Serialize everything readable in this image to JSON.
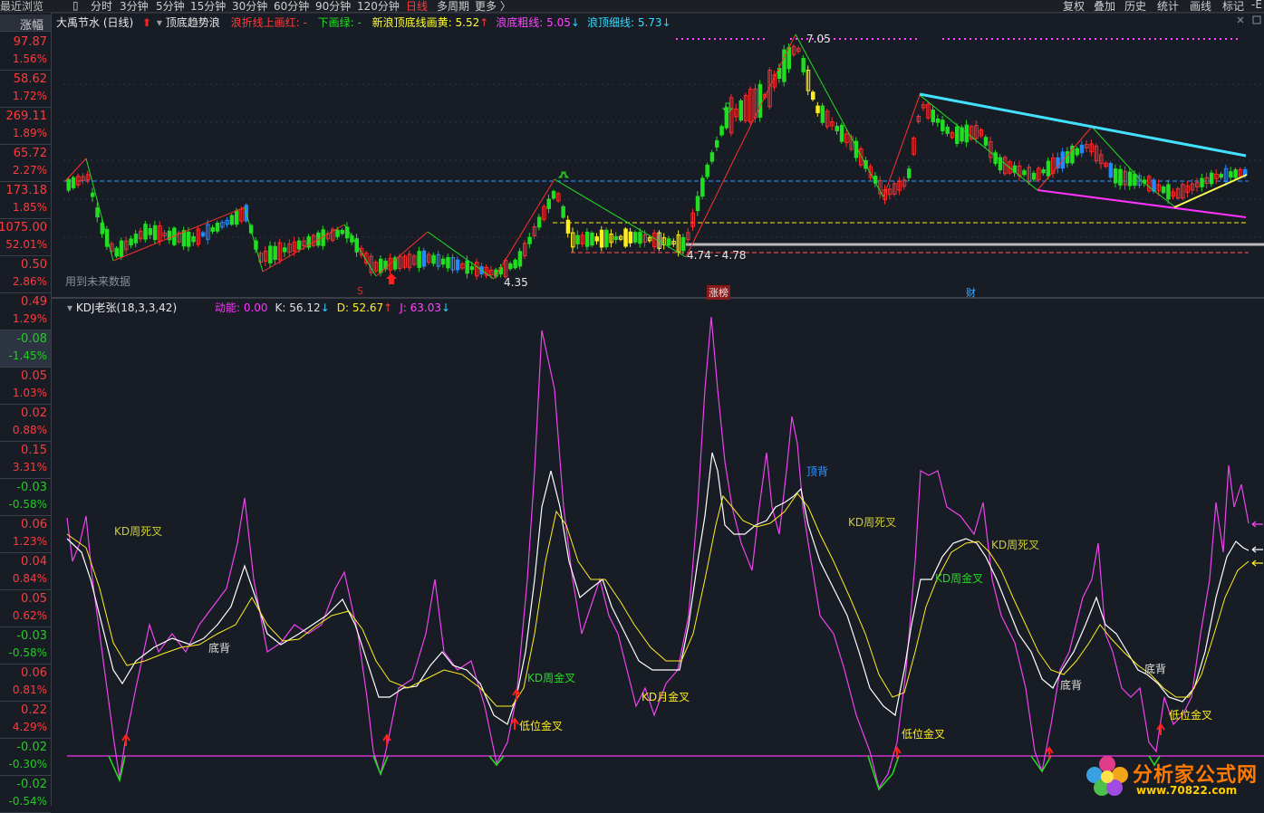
{
  "topbar": {
    "recent": "最近浏览",
    "periods": [
      "分时",
      "3分钟",
      "5分钟",
      "15分钟",
      "30分钟",
      "60分钟",
      "90分钟",
      "120分钟",
      "日线",
      "多周期",
      "更多 〉"
    ],
    "active_period": "日线",
    "right_buttons": [
      "复权",
      "叠加",
      "历史",
      "统计",
      "画线",
      "标记"
    ],
    "edge": "-E"
  },
  "sidebar": {
    "header": "涨幅",
    "items": [
      {
        "price": "97.87",
        "change": "1.56%",
        "dir": "up"
      },
      {
        "price": "58.62",
        "change": "1.72%",
        "dir": "up"
      },
      {
        "price": "269.11",
        "change": "1.89%",
        "dir": "up"
      },
      {
        "price": "65.72",
        "change": "2.27%",
        "dir": "up"
      },
      {
        "price": "173.18",
        "change": "1.85%",
        "dir": "up"
      },
      {
        "price": "1075.00",
        "change": "52.01%",
        "dir": "up"
      },
      {
        "price": "0.50",
        "change": "2.86%",
        "dir": "up"
      },
      {
        "price": "0.49",
        "change": "1.29%",
        "dir": "up"
      },
      {
        "price": "-0.08",
        "change": "-1.45%",
        "dir": "down",
        "selected": true
      },
      {
        "price": "0.05",
        "change": "1.03%",
        "dir": "up"
      },
      {
        "price": "0.02",
        "change": "0.88%",
        "dir": "up"
      },
      {
        "price": "0.15",
        "change": "3.31%",
        "dir": "up"
      },
      {
        "price": "-0.03",
        "change": "-0.58%",
        "dir": "down"
      },
      {
        "price": "0.06",
        "change": "1.23%",
        "dir": "up"
      },
      {
        "price": "0.04",
        "change": "0.84%",
        "dir": "up"
      },
      {
        "price": "0.05",
        "change": "0.62%",
        "dir": "up"
      },
      {
        "price": "-0.03",
        "change": "-0.58%",
        "dir": "down"
      },
      {
        "price": "0.06",
        "change": "0.81%",
        "dir": "up"
      },
      {
        "price": "0.22",
        "change": "4.29%",
        "dir": "up"
      },
      {
        "price": "-0.02",
        "change": "-0.30%",
        "dir": "down"
      },
      {
        "price": "-0.02",
        "change": "-0.54%",
        "dir": "down"
      }
    ]
  },
  "price_panel": {
    "title": "大禹节水 (日线)",
    "indicator": "顶底趋势浪",
    "legend": [
      {
        "text": "浪折线上画红:",
        "value": " - ",
        "color": "#ff3b3b"
      },
      {
        "text": "下画绿:",
        "value": " - ",
        "color": "#22dd22"
      },
      {
        "text": "新浪顶底线画黄:",
        "value": " 5.52",
        "arrow": "↑",
        "color": "#ffff33",
        "arrow_color": "#ff3b3b"
      },
      {
        "text": "浪底粗线:",
        "value": " 5.05",
        "arrow": "↓",
        "color": "#ff44ff",
        "arrow_color": "#33ccff"
      },
      {
        "text": "浪顶细线:",
        "value": " 5.73",
        "arrow": "↓",
        "color": "#33ddff",
        "arrow_color": "#33ccff"
      }
    ],
    "high_label": "7.05",
    "low_label1": "4.35",
    "low_label2": "4.74 - 4.78",
    "future_data_note": "用到未来数据",
    "markers": {
      "s_marker": "S",
      "zhangbang": "涨榜",
      "cai": "财"
    },
    "colors": {
      "up": "#ff2b2b",
      "down": "#22dd22",
      "blue": "#2288ff",
      "yellow": "#ffee22",
      "trend_up": "#ff3030",
      "trend_down": "#22dd22",
      "cyan": "#44e0ff",
      "magenta": "#ff33ff"
    }
  },
  "kdj_panel": {
    "title": "KDJ老张(18,3,3,42)",
    "legend": [
      {
        "text": "动能:",
        "value": " 0.00",
        "color": "#ff33ff"
      },
      {
        "text": "K:",
        "value": " 56.12",
        "arrow": "↓",
        "color": "#e0e0e0",
        "arrow_color": "#33ccff"
      },
      {
        "text": "D:",
        "value": " 52.67",
        "arrow": "↑",
        "color": "#ffee22",
        "arrow_color": "#ff3b3b"
      },
      {
        "text": "J:",
        "value": " 63.03",
        "arrow": "↓",
        "color": "#ff44ff",
        "arrow_color": "#33ccff"
      }
    ],
    "annotations": [
      {
        "text": "KD周死叉",
        "color": "#cccc33"
      },
      {
        "text": "底背",
        "color": "#e0e0e0"
      },
      {
        "text": "KD周金叉",
        "color": "#22dd22"
      },
      {
        "text": "低位金叉",
        "color": "#ffee22"
      },
      {
        "text": "KD月金叉",
        "color": "#ffee22"
      },
      {
        "text": "顶背",
        "color": "#3399ff"
      },
      {
        "text": "KD周死叉",
        "color": "#cccc33"
      },
      {
        "text": "KD周金叉",
        "color": "#22dd22"
      },
      {
        "text": "KD周死叉",
        "color": "#cccc33"
      },
      {
        "text": "低位金叉",
        "color": "#ffee22"
      },
      {
        "text": "底背",
        "color": "#e0e0e0"
      },
      {
        "text": "底背",
        "color": "#e0e0e0"
      },
      {
        "text": "低位金叉",
        "color": "#ffee22"
      }
    ],
    "colors": {
      "K": "#ffffff",
      "D": "#ffee22",
      "J": "#ee44ee",
      "baseline": "#cc33cc"
    }
  },
  "watermark": {
    "title": "分析家公式网",
    "url": "www.70822.com"
  }
}
